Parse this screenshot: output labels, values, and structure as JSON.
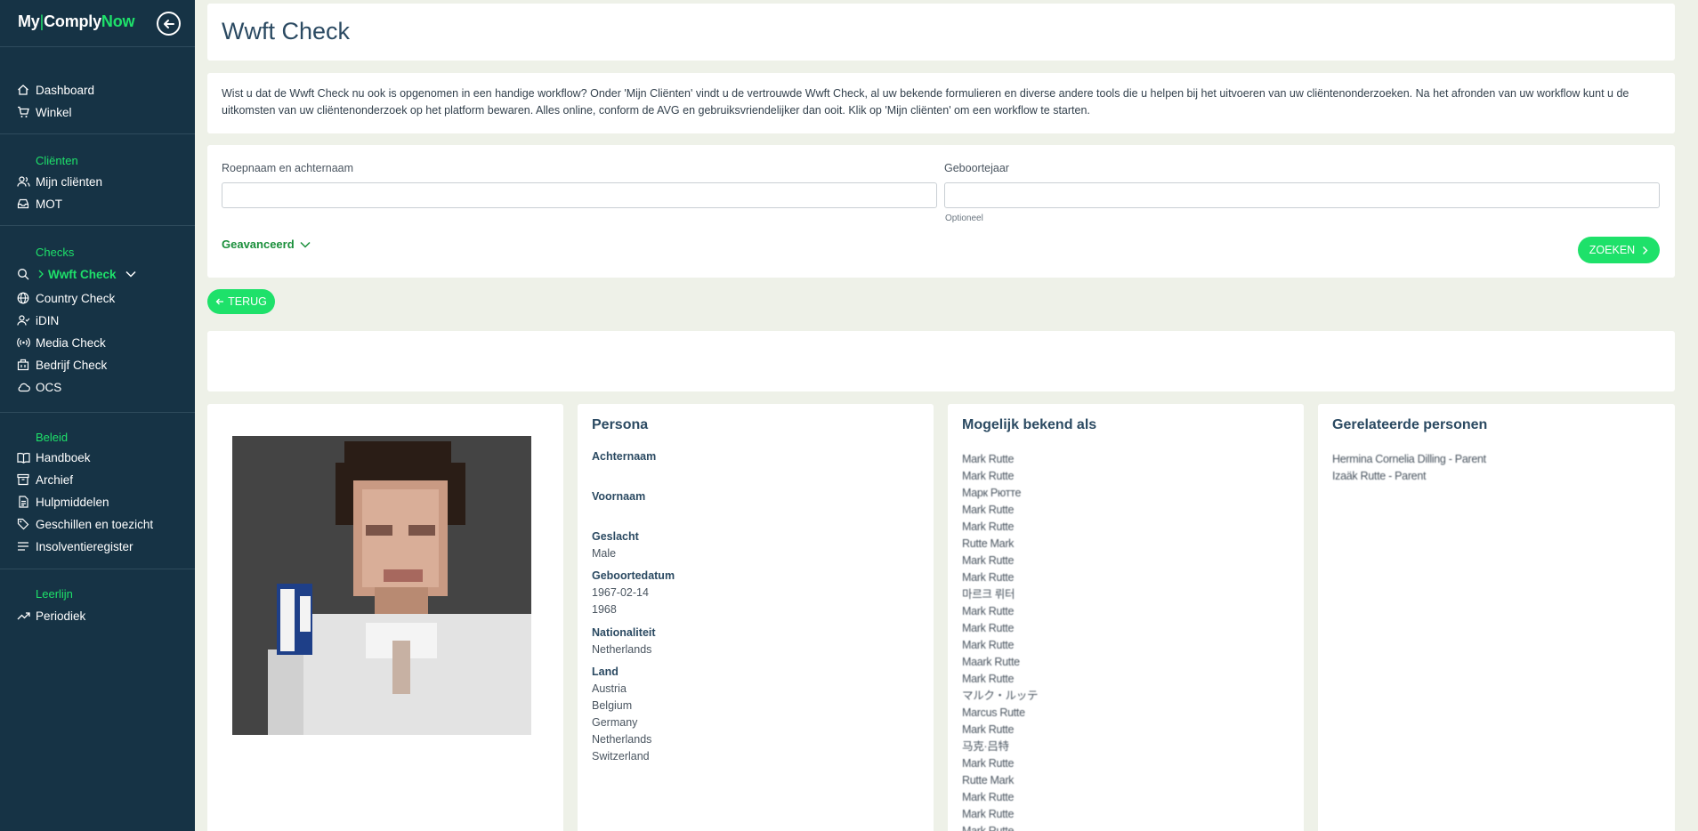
{
  "logo": {
    "my": "My",
    "sep": "|",
    "comply": "Comply",
    "now": "Now"
  },
  "sidebar": {
    "top_items": [
      {
        "label": "Dashboard",
        "icon": "home-icon"
      },
      {
        "label": "Winkel",
        "icon": "cart-icon"
      }
    ],
    "sections": [
      {
        "title": "Cliënten",
        "items": [
          {
            "label": "Mijn cliënten",
            "icon": "users-icon"
          },
          {
            "label": "MOT",
            "icon": "inbox-icon"
          }
        ]
      },
      {
        "title": "Checks",
        "items": [
          {
            "label": "Wwft Check",
            "icon": "search-icon",
            "active": true
          },
          {
            "label": "Country Check",
            "icon": "globe-icon"
          },
          {
            "label": "iDIN",
            "icon": "user-check-icon"
          },
          {
            "label": "Media Check",
            "icon": "broadcast-icon"
          },
          {
            "label": "Bedrijf Check",
            "icon": "building-icon"
          },
          {
            "label": "OCS",
            "icon": "cloud-icon"
          }
        ]
      },
      {
        "title": "Beleid",
        "items": [
          {
            "label": "Handboek",
            "icon": "book-icon"
          },
          {
            "label": "Archief",
            "icon": "archive-icon"
          },
          {
            "label": "Hulpmiddelen",
            "icon": "document-icon"
          },
          {
            "label": "Geschillen en toezicht",
            "icon": "tag-icon"
          },
          {
            "label": "Insolventieregister",
            "icon": "list-icon"
          }
        ]
      },
      {
        "title": "Leerlijn",
        "items": [
          {
            "label": "Periodiek",
            "icon": "trend-icon"
          }
        ]
      }
    ]
  },
  "header": {
    "title": "Wwft Check"
  },
  "info": {
    "text": "Wist u dat de Wwft Check nu ook is opgenomen in een handige workflow? Onder 'Mijn Cliënten' vindt u de vertrouwde Wwft Check, al uw bekende formulieren en diverse andere tools die u helpen bij het uitvoeren van uw cliëntenonderzoeken. Na het afronden van uw workflow kunt u de uitkomsten van uw cliëntenonderzoek op het platform bewaren. Alles online, conform de AVG en gebruiksvriendelijker dan ooit. Klik op 'Mijn cliënten' om een workflow te starten."
  },
  "search": {
    "name_label": "Roepnaam en achternaam",
    "name_value": "",
    "year_label": "Geboortejaar",
    "year_value": "",
    "year_hint": "Optioneel",
    "advanced_label": "Geavanceerd",
    "search_button": "ZOEKEN"
  },
  "back_button": "TERUG",
  "persona": {
    "title": "Persona",
    "achternaam_label": "Achternaam",
    "voornaam_label": "Voornaam",
    "geslacht_label": "Geslacht",
    "geslacht_value": "Male",
    "geboortedatum_label": "Geboortedatum",
    "geboortedatum_values": [
      "1967-02-14",
      "1968"
    ],
    "nationaliteit_label": "Nationaliteit",
    "nationaliteit_value": "Netherlands",
    "land_label": "Land",
    "land_values": [
      "Austria",
      "Belgium",
      "Germany",
      "Netherlands",
      "Switzerland"
    ]
  },
  "aliases": {
    "title": "Mogelijk bekend als",
    "items": [
      "Mark Rutte",
      "Mark Rutte",
      "Марк Рютте",
      "Mark Rutte",
      "Mark Rutte",
      "Rutte Mark",
      "Mark Rutte",
      "Mark Rutte",
      "마르크 뤼터",
      "Mark Rutte",
      "Mark Rutte",
      "Mark Rutte",
      "Maark Rutte",
      "Mark Rutte",
      "マルク・ルッテ",
      "Marcus Rutte",
      "Mark Rutte",
      "马克·吕特",
      "Mark Rutte",
      "Rutte Mark",
      "Mark Rutte",
      "Mark Rutte",
      "Mark Rutte"
    ]
  },
  "related": {
    "title": "Gerelateerde personen",
    "items": [
      "Hermina Cornelia Dilling - Parent",
      "Izaäk Rutte - Parent"
    ]
  }
}
